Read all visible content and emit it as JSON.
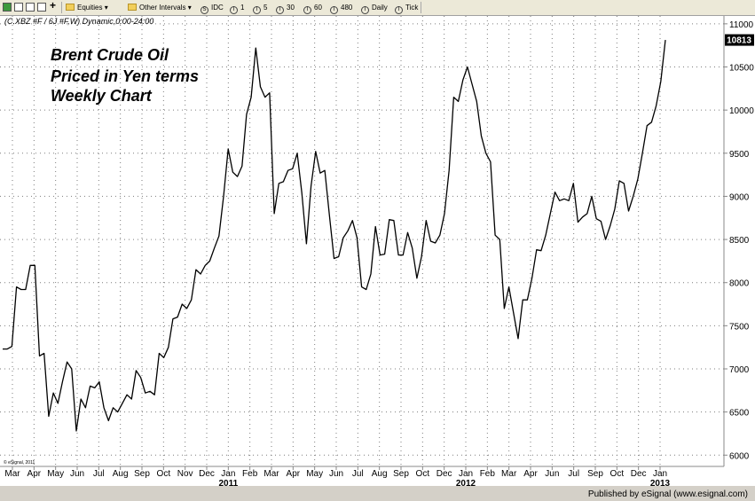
{
  "toolbar": {
    "equities_label": "Equities",
    "intervals_label": "Other Intervals",
    "idc_label": "IDC",
    "buttons": [
      "1",
      "5",
      "30",
      "60",
      "480",
      "Daily",
      "Tick"
    ]
  },
  "header_text": "(C.XBZ #F / 6J #F,W) Dynamic,0:00-24:00",
  "publisher": "Published by eSignal (www.esignal.com)",
  "copyright": "© eSignal, 2011",
  "colors": {
    "line": "#000000",
    "price_box": "#000000",
    "annotation": "#000000"
  },
  "chart_data": {
    "type": "line",
    "annotation": [
      "Brent Crude Oil",
      "Priced in Yen terms",
      "Weekly Chart"
    ],
    "last_value_label": "10813",
    "ylim": [
      5900,
      11050
    ],
    "yticks": [
      6000,
      6500,
      7000,
      7500,
      8000,
      8500,
      9000,
      9500,
      10000,
      10500,
      11000
    ],
    "x_month_labels": [
      "Mar",
      "Apr",
      "May",
      "Jun",
      "Jul",
      "Aug",
      "Sep",
      "Oct",
      "Nov",
      "Dec",
      "Jan",
      "Feb",
      "Mar",
      "Apr",
      "May",
      "Jun",
      "Jul",
      "Aug",
      "Sep",
      "Oct",
      "Dec",
      "Jan",
      "Feb",
      "Mar",
      "Apr",
      "Jun",
      "Jul",
      "Sep",
      "Oct",
      "Dec",
      "Jan"
    ],
    "x_year_labels": [
      "2011",
      "2012",
      "2013"
    ],
    "grid": true,
    "series": [
      {
        "values": [
          7230,
          7230,
          7260,
          7950,
          7920,
          7920,
          8200,
          8200,
          7150,
          7180,
          6450,
          6720,
          6600,
          6850,
          7080,
          7000,
          6280,
          6650,
          6550,
          6800,
          6780,
          6850,
          6550,
          6400,
          6550,
          6500,
          6600,
          6700,
          6650,
          6980,
          6900,
          6720,
          6740,
          6700,
          7180,
          7130,
          7250,
          7580,
          7600,
          7750,
          7700,
          7800,
          8150,
          8100,
          8200,
          8250,
          8400,
          8540,
          9000,
          9550,
          9280,
          9230,
          9350,
          9950,
          10150,
          10720,
          10270,
          10150,
          10200,
          8800,
          9150,
          9170,
          9300,
          9320,
          9500,
          9040,
          8450,
          9120,
          9520,
          9270,
          9300,
          8780,
          8280,
          8300,
          8520,
          8600,
          8720,
          8520,
          7950,
          7920,
          8100,
          8650,
          8320,
          8330,
          8730,
          8720,
          8320,
          8320,
          8580,
          8400,
          8050,
          8300,
          8720,
          8480,
          8460,
          8550,
          8800,
          9300,
          10150,
          10100,
          10350,
          10500,
          10300,
          10100,
          9700,
          9500,
          9400,
          8550,
          8500,
          7700,
          7950,
          7650,
          7350,
          7800,
          7800,
          8050,
          8380,
          8370,
          8550,
          8800,
          9050,
          8950,
          8970,
          8950,
          9150,
          8700,
          8760,
          8800,
          9000,
          8740,
          8710,
          8500,
          8660,
          8850,
          9180,
          9150,
          8830,
          9000,
          9200,
          9500,
          9820,
          9860,
          10050,
          10330,
          10813
        ]
      }
    ]
  }
}
